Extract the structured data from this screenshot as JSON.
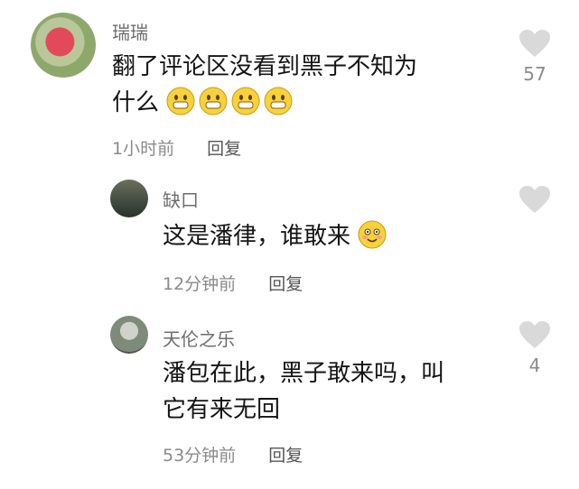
{
  "comments": [
    {
      "author": "瑞瑞",
      "text_line1": "翻了评论区没看到黑子不知为",
      "text_line2": "什么",
      "emoji": [
        "grin-emoji",
        "grin-emoji",
        "grin-emoji",
        "grin-emoji"
      ],
      "time": "1小时前",
      "reply": "回复",
      "likes": "57"
    },
    {
      "author": "缺口",
      "text_line1": "这是潘律，谁敢来",
      "emoji": [
        "smile-emoji"
      ],
      "time": "12分钟前",
      "reply": "回复",
      "likes": ""
    },
    {
      "author": "天伦之乐",
      "text_line1": "潘包在此，黑子敢来吗，叫",
      "text_line2": "它有来无回",
      "time": "53分钟前",
      "reply": "回复",
      "likes": "4"
    }
  ],
  "colors": {
    "like_icon": "#d9d9d9",
    "emoji_face": "#f7d23a"
  }
}
